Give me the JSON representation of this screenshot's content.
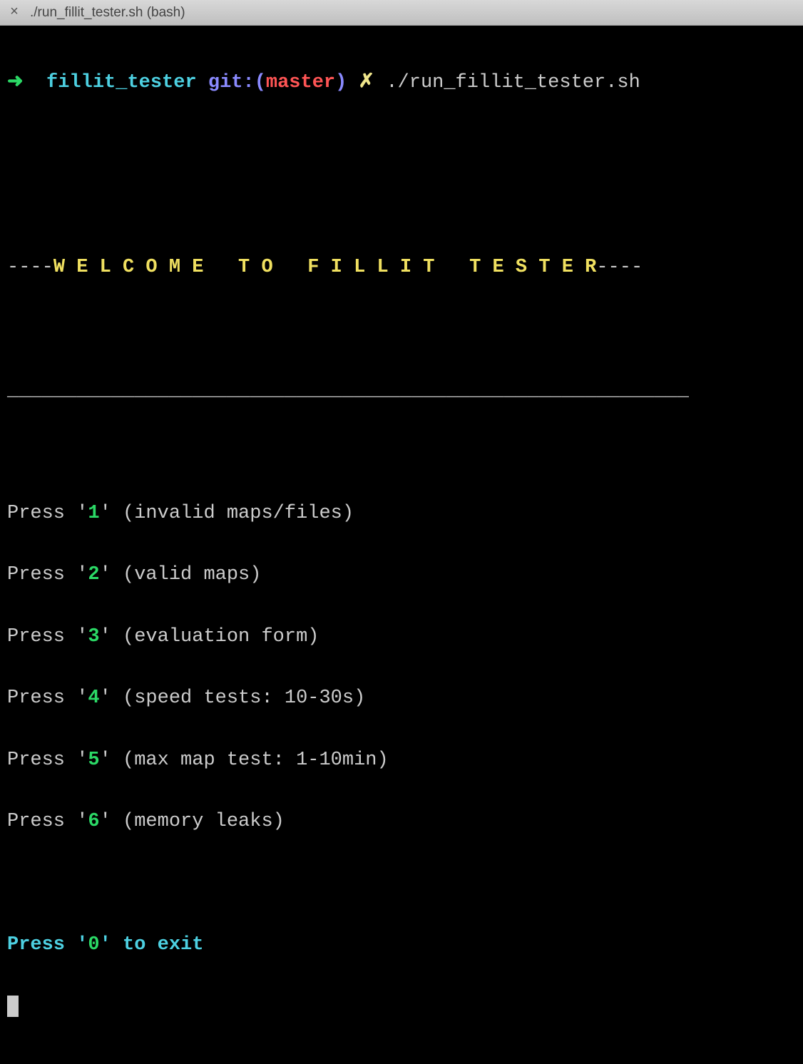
{
  "titlebar": {
    "close_glyph": "×",
    "title": "./run_fillit_tester.sh (bash)"
  },
  "prompt": {
    "arrow": "➜",
    "directory": "fillit_tester",
    "git_label": "git:",
    "git_open": "(",
    "branch": "master",
    "git_close": ")",
    "dirty": "✗",
    "command": "./run_fillit_tester.sh"
  },
  "banner": {
    "prefix": "----",
    "text": "W E L C O M E   T O   F I L L I T   T E S T E R",
    "suffix": "----"
  },
  "divider": "___________________________________________________________",
  "menu": [
    {
      "press": "Press ",
      "q1": "'",
      "num": "1",
      "q2": "'",
      "desc": " (invalid maps/files)"
    },
    {
      "press": "Press ",
      "q1": "'",
      "num": "2",
      "q2": "'",
      "desc": " (valid maps)"
    },
    {
      "press": "Press ",
      "q1": "'",
      "num": "3",
      "q2": "'",
      "desc": " (evaluation form)"
    },
    {
      "press": "Press ",
      "q1": "'",
      "num": "4",
      "q2": "'",
      "desc": " (speed tests: 10-30s)"
    },
    {
      "press": "Press ",
      "q1": "'",
      "num": "5",
      "q2": "'",
      "desc": " (max map test: 1-10min)"
    },
    {
      "press": "Press ",
      "q1": "'",
      "num": "6",
      "q2": "'",
      "desc": " (memory leaks)"
    }
  ],
  "exit": {
    "press": "Press ",
    "q1": "'",
    "num": "0",
    "q2": "'",
    "desc": " to exit"
  }
}
